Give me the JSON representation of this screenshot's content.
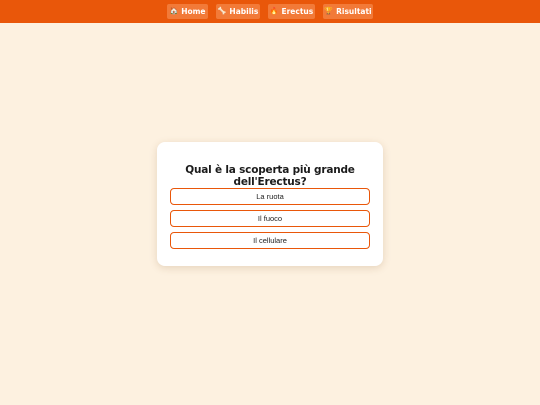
{
  "nav": {
    "items": [
      {
        "label": "Home",
        "icon": "🏠"
      },
      {
        "label": "Habilis",
        "icon": "🦴"
      },
      {
        "label": "Erectus",
        "icon": "🔥"
      },
      {
        "label": "Risultati",
        "icon": "🏆"
      }
    ]
  },
  "quiz": {
    "question": "Qual è la scoperta più grande dell'Erectus?",
    "answers": [
      "La ruota",
      "Il fuoco",
      "Il cellulare"
    ]
  },
  "colors": {
    "accent": "#e9570a",
    "background": "#fdf1e0"
  }
}
